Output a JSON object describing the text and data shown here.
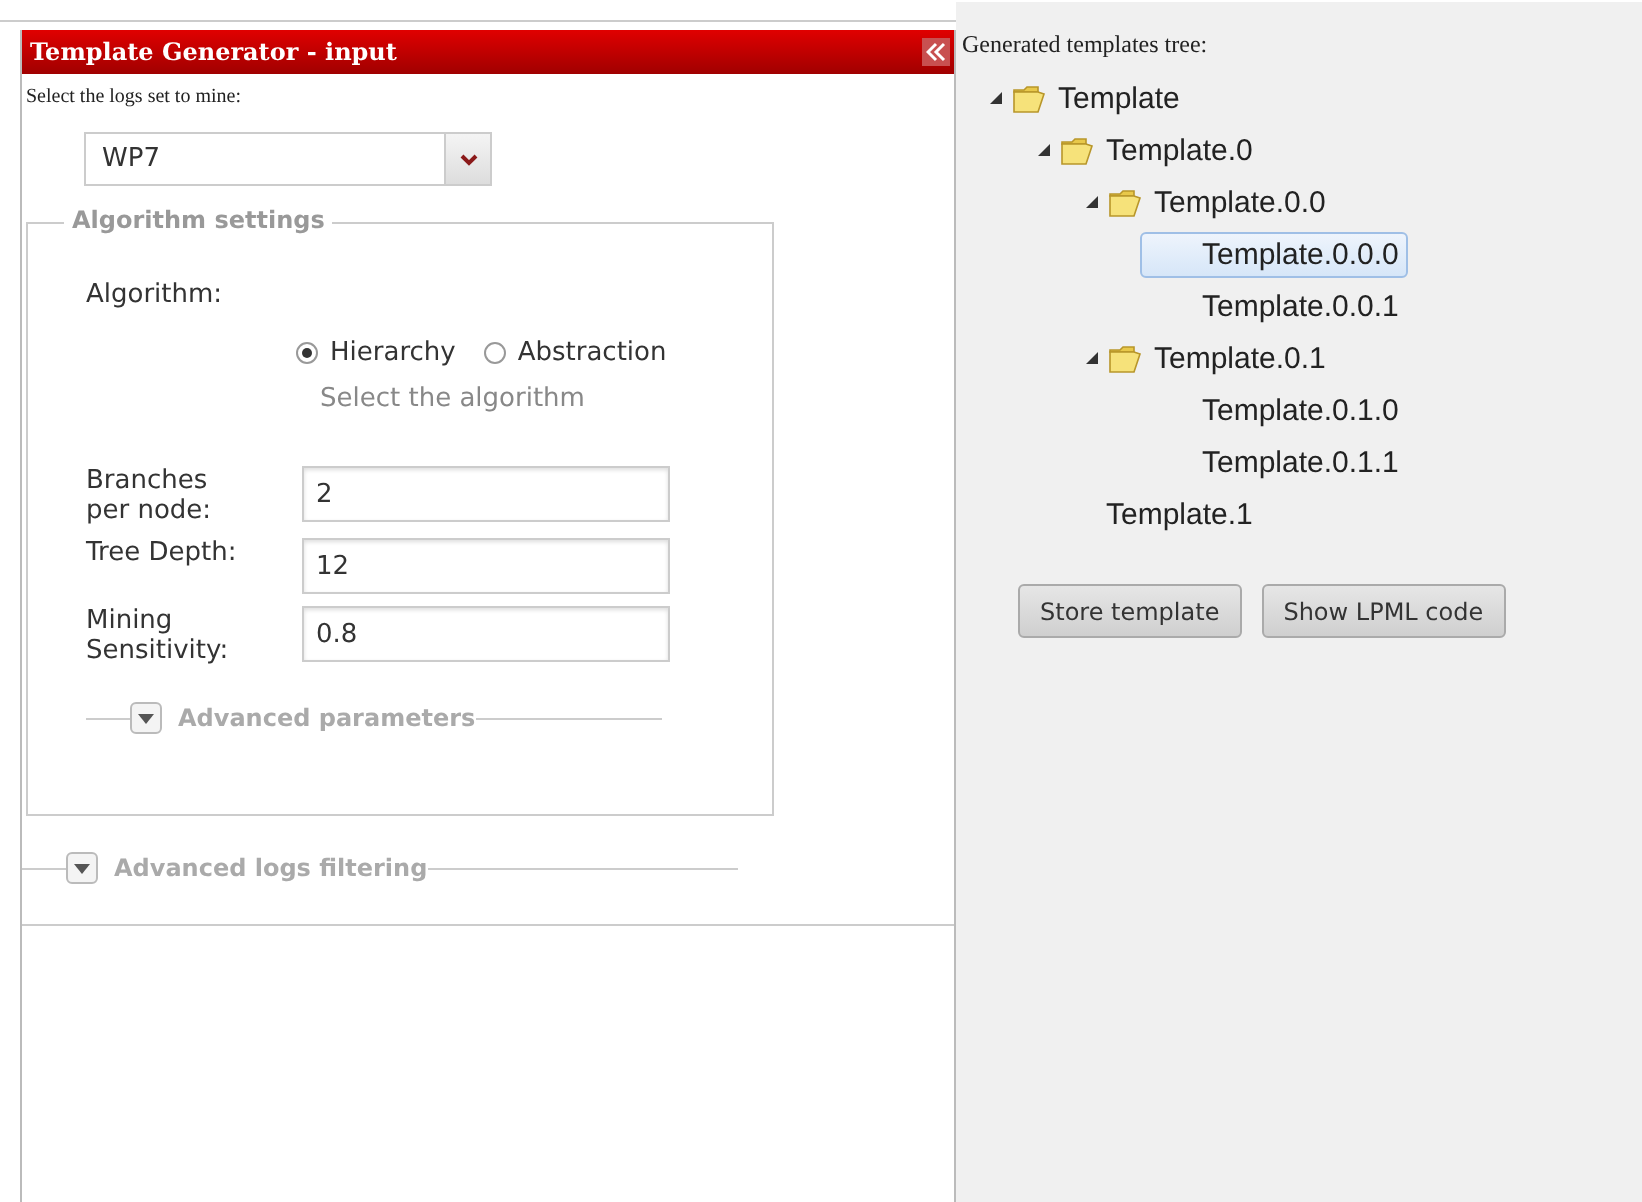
{
  "panel": {
    "title": "Template Generator - input",
    "logs_label": "Select the logs set to mine:",
    "logs_select": {
      "value": "WP7"
    },
    "algorithm_settings": {
      "legend": "Algorithm settings",
      "algorithm_label": "Algorithm:",
      "algorithm_options": [
        {
          "label": "Hierarchy",
          "selected": true
        },
        {
          "label": "Abstraction",
          "selected": false
        }
      ],
      "algorithm_hint": "Select the algorithm",
      "fields": [
        {
          "label": "Branches per node:",
          "value": "2"
        },
        {
          "label": "Tree Depth:",
          "value": "12"
        },
        {
          "label": "Mining Sensitivity:",
          "value": "0.8"
        }
      ],
      "advanced_parameters": {
        "label": "Advanced parameters",
        "expanded": false
      }
    },
    "advanced_logs_filtering": {
      "label": "Advanced logs filtering",
      "expanded": false
    }
  },
  "tree_pane": {
    "title": "Generated templates tree:",
    "tree": [
      {
        "label": "Template",
        "expanded": true,
        "selected": false,
        "children": [
          {
            "label": "Template.0",
            "expanded": true,
            "selected": false,
            "children": [
              {
                "label": "Template.0.0",
                "expanded": true,
                "selected": false,
                "children": [
                  {
                    "label": "Template.0.0.0",
                    "selected": true
                  },
                  {
                    "label": "Template.0.0.1",
                    "selected": false
                  }
                ]
              },
              {
                "label": "Template.0.1",
                "expanded": true,
                "selected": false,
                "children": [
                  {
                    "label": "Template.0.1.0",
                    "selected": false
                  },
                  {
                    "label": "Template.0.1.1",
                    "selected": false
                  }
                ]
              }
            ]
          },
          {
            "label": "Template.1",
            "selected": false
          }
        ]
      }
    ],
    "buttons": [
      "Store template",
      "Show LPML code"
    ]
  }
}
